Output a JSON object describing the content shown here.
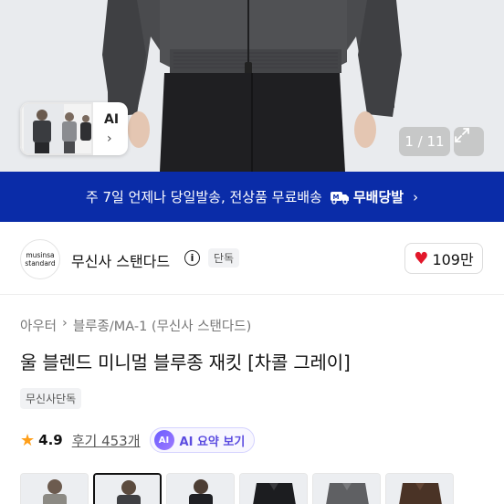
{
  "hero": {
    "thumbnail_label": "AI",
    "counter": "1 / 11"
  },
  "banner": {
    "text": "주 7일 언제나 당일발송, 전상품 무료배송",
    "badge": "무배당발"
  },
  "brand": {
    "logo_line1": "musinsa",
    "logo_line2": "standard",
    "name": "무신사 스탠다드",
    "exclusive": "단독",
    "likes": "109만"
  },
  "breadcrumb": [
    "아우터",
    "블루종/MA-1 (무신사 스탠다드)"
  ],
  "product": {
    "title": "울 블렌드 미니멀 블루종 재킷 [차콜 그레이]",
    "tag": "무신사단독",
    "rating": "4.9",
    "reviews": "후기 453개",
    "ai_summary": "AI 요약 보기",
    "ai_icon": "AI"
  },
  "colors": {
    "accent_blue": "#0a2ca8",
    "heart_red": "#e2172a",
    "star_orange": "#ff9f1a",
    "ai_purple": "#5b4ce0"
  }
}
